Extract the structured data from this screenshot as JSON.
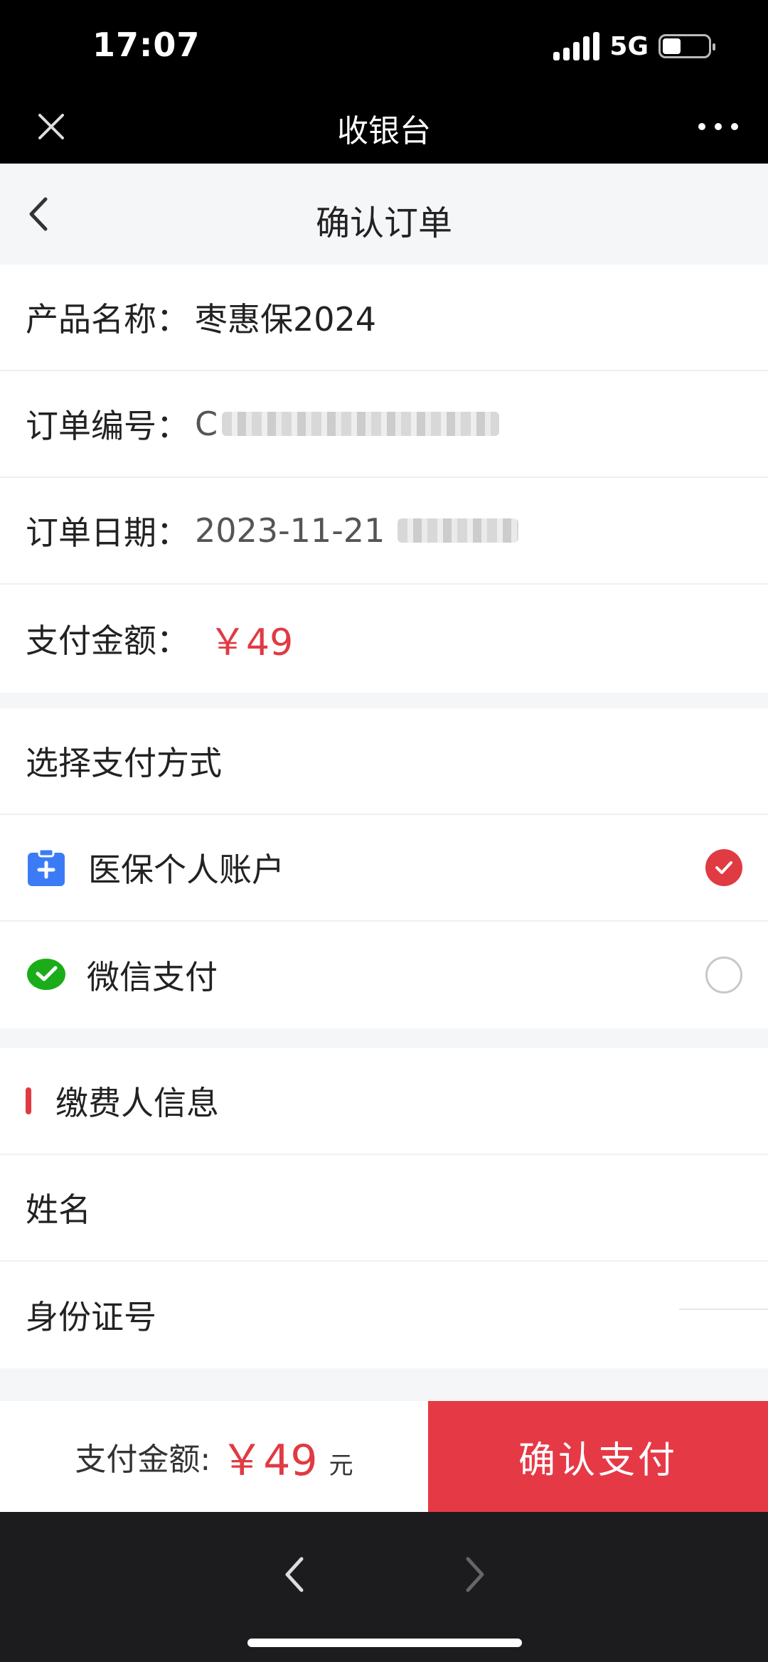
{
  "status_bar": {
    "time": "17:07",
    "network": "5G",
    "battery_level": 0.4
  },
  "header": {
    "title": "收银台"
  },
  "nav": {
    "title": "确认订单"
  },
  "order": {
    "product_label": "产品名称：",
    "product_value": "枣惠保2024",
    "order_no_label": "订单编号：",
    "order_no_prefix": "C",
    "date_label": "订单日期：",
    "date_value": "2023-11-21",
    "amount_label": "支付金额：",
    "amount_value": "￥49"
  },
  "payment": {
    "section_title": "选择支付方式",
    "methods": [
      {
        "label": "医保个人账户",
        "icon": "medical-card-icon",
        "selected": true
      },
      {
        "label": "微信支付",
        "icon": "wechat-pay-icon",
        "selected": false
      }
    ]
  },
  "payer": {
    "section_title": "缴费人信息",
    "name_label": "姓名",
    "id_label": "身份证号"
  },
  "pay_bar": {
    "amount_label": "支付金额:",
    "amount": "￥49",
    "unit": "元",
    "confirm_label": "确认支付"
  },
  "colors": {
    "accent_red": "#e63946",
    "wechat_green": "#1aad19",
    "medical_blue": "#3b7cf6"
  }
}
